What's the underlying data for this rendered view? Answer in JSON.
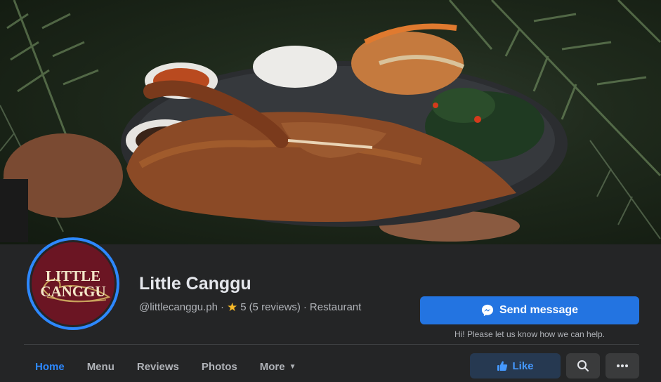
{
  "cover": {
    "alt_icon": "cover-photo-roast-duck"
  },
  "profile": {
    "logo_line1": "LITTLE",
    "logo_line2": "CANGGU",
    "name": "Little Canggu",
    "handle": "@littlecanggu.ph",
    "separator": "·",
    "rating": "5",
    "reviews": "(5 reviews)",
    "category": "Restaurant"
  },
  "actions": {
    "send_message": "Send message",
    "help_text": "Hi! Please let us know how we can help.",
    "like": "Like"
  },
  "tabs": [
    {
      "label": "Home"
    },
    {
      "label": "Menu"
    },
    {
      "label": "Reviews"
    },
    {
      "label": "Photos"
    },
    {
      "label": "More"
    }
  ],
  "colors": {
    "accent": "#2d88ff",
    "button_primary": "#2374e1",
    "avatar_bg": "#6b1523",
    "star": "#f7b928"
  }
}
